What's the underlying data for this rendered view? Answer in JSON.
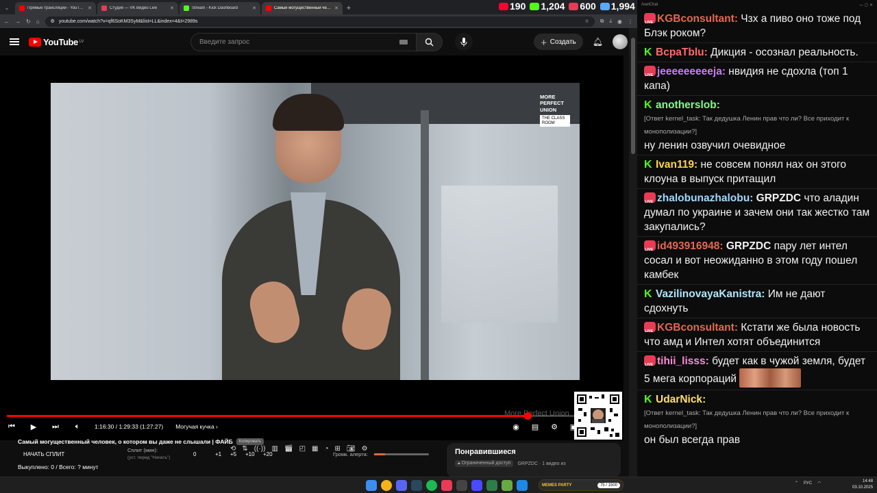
{
  "browser": {
    "tabs": [
      {
        "title": "Прямые трансляции - YouTube",
        "color": "#ff0000",
        "active": false
      },
      {
        "title": "Студия — VK Видео Live",
        "color": "#e83b56",
        "active": false
      },
      {
        "title": "Stream - Kick Dashboard",
        "color": "#53fc18",
        "active": false
      },
      {
        "title": "Самый могущественный чел...",
        "color": "#ff0000",
        "active": true
      }
    ],
    "url": "youtube.com/watch?v=qf6SoKM3SyM&list=LL&index=4&t=2989s"
  },
  "viewers": [
    {
      "platform": "youtube",
      "count": "190",
      "color": "#ff0033"
    },
    {
      "platform": "kick",
      "count": "1,204",
      "color": "#53fc18"
    },
    {
      "platform": "vk",
      "count": "600",
      "color": "#e83b56"
    },
    {
      "platform": "total",
      "count": "1,994",
      "color": "#5aa9ff"
    }
  ],
  "youtube": {
    "logo_text": "YouTube",
    "region": "LV",
    "search_placeholder": "Введите запрос",
    "create_label": "Создать",
    "video": {
      "brand_line1": "MORE",
      "brand_line2": "PERFECT",
      "brand_line3": "UNION",
      "brand_sub1": "THE CLASS",
      "brand_sub2": "ROOM",
      "watermark": "More Perfect Union"
    },
    "player": {
      "time": "1:16:30 / 1:29:33 (1:27:27)",
      "chapter": "Могучая кучка",
      "progress_fraction": 0.854
    },
    "bottom": {
      "video_title": "Самый могущественный человек, о котором вы даже не слышали | ФАЙБ",
      "copy_label": "Копировать",
      "split_button": "НАЧАТЬ СПЛИТ",
      "split_label": "Сплит (мин):",
      "split_hint": "(уст. перед \"Начать\")",
      "split_value": "0",
      "inc1": "+1",
      "inc5": "+5",
      "inc10": "+10",
      "inc20": "+20",
      "alert_label": "Громк. алерта:",
      "alert_level": 0.2,
      "bought": "Выкуплено: 0 / Всего: ? минут"
    },
    "liked": {
      "title": "Понравившиеся",
      "access": "Ограниченный доступ",
      "meta": "GRPZDC · 1 видео из"
    }
  },
  "chat": {
    "title": "AxelChat",
    "messages": [
      {
        "platform": "vk",
        "nick": "KGBconsultant",
        "color": "#e8674f",
        "text": "Чзх а пиво оно тоже под Блэк роком?"
      },
      {
        "platform": "kick",
        "nick": "BcpaTblu",
        "color": "#ff6b6b",
        "text": "Дикция - осознал реальность."
      },
      {
        "platform": "vk",
        "nick": "jeeeeeeeeeja",
        "color": "#c77dff",
        "text": "нвидия не сдохла (топ 1 капа)"
      },
      {
        "platform": "kick",
        "nick": "anotherslob",
        "color": "#7dff8a",
        "reply": "[Ответ kernel_task: Так дедушка Ленин прав что ли? Все приходит к монополизации?]",
        "text": "ну ленин озвучил очевидное"
      },
      {
        "platform": "kick",
        "nick": "Ivan119",
        "color": "#ffd54f",
        "text": "не совсем понял нах он этого клоуна в выпуск притащил"
      },
      {
        "platform": "vk",
        "nick": "zhalobunazhalobu",
        "color": "#9fd8ff",
        "strong": "GRPZDC",
        "text": "что аладин думал по украине и зачем они так жестко там закупались?"
      },
      {
        "platform": "vk",
        "nick": "id493916948",
        "color": "#e8674f",
        "strong": "GRPZDC",
        "text": "пару лет интел сосал и вот неожиданно в этом году пошел камбек"
      },
      {
        "platform": "kick",
        "nick": "VazilinovayaKanistra",
        "color": "#aee8ff",
        "text": "Им не дают сдохнуть"
      },
      {
        "platform": "vk",
        "nick": "KGBconsultant",
        "color": "#e8674f",
        "text": "Кстати же была новость что амд и Интел хотят объединится"
      },
      {
        "platform": "vk",
        "nick": "tihii_lisss",
        "color": "#ff8ad8",
        "text": "будет как в чужой земля, будет 5 мега корпораций"
      },
      {
        "platform": "kick",
        "nick": "UdarNick",
        "color": "#ffe066",
        "reply": "[Ответ kernel_task: Так дедушка Ленин прав что ли? Все приходит к монополизации?]",
        "text": "он был всегда прав"
      }
    ]
  },
  "taskbar": {
    "memes_title": "MEMES PARTY",
    "memes_count": "75 / 1500",
    "lang": "РУС",
    "time": "14:48",
    "date": "03.10.2025"
  }
}
